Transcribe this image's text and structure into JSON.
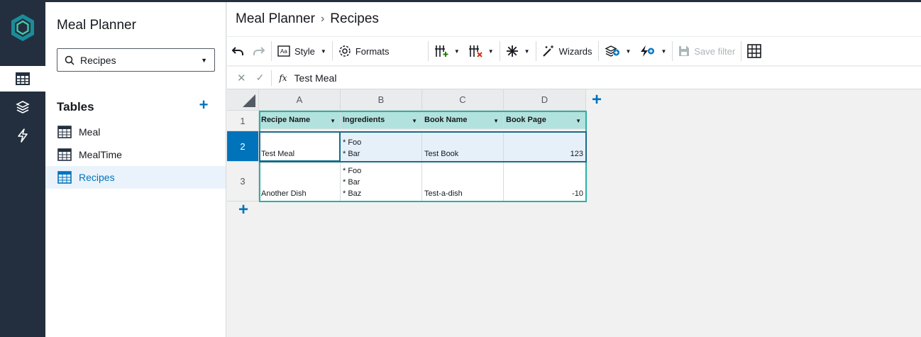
{
  "app": {
    "title": "Meal Planner"
  },
  "breadcrumb": {
    "root": "Meal Planner",
    "current": "Recipes"
  },
  "page_select": {
    "value": "Recipes"
  },
  "tables": {
    "heading": "Tables",
    "items": [
      {
        "label": "Meal",
        "active": false
      },
      {
        "label": "MealTime",
        "active": false
      },
      {
        "label": "Recipes",
        "active": true
      }
    ]
  },
  "toolbar": {
    "style_label": "Style",
    "formats_label": "Formats",
    "wizards_label": "Wizards",
    "save_filter_label": "Save filter"
  },
  "formula_bar": {
    "fx": "fx",
    "value": "Test Meal"
  },
  "grid": {
    "columns": [
      "A",
      "B",
      "C",
      "D"
    ],
    "row_numbers": [
      "1",
      "2",
      "3"
    ],
    "headers": [
      "Recipe Name",
      "Ingredients",
      "Book Name",
      "Book Page"
    ],
    "rows": [
      [
        "Test Meal",
        "* Foo\n* Bar",
        "Test Book",
        "123"
      ],
      [
        "Another Dish",
        "* Foo\n* Bar\n* Baz",
        "Test-a-dish",
        "-10"
      ]
    ],
    "selected_row": "2"
  },
  "colors": {
    "accent": "#0073bb",
    "header_fill": "#b2e2de",
    "rail": "#232f3e"
  }
}
